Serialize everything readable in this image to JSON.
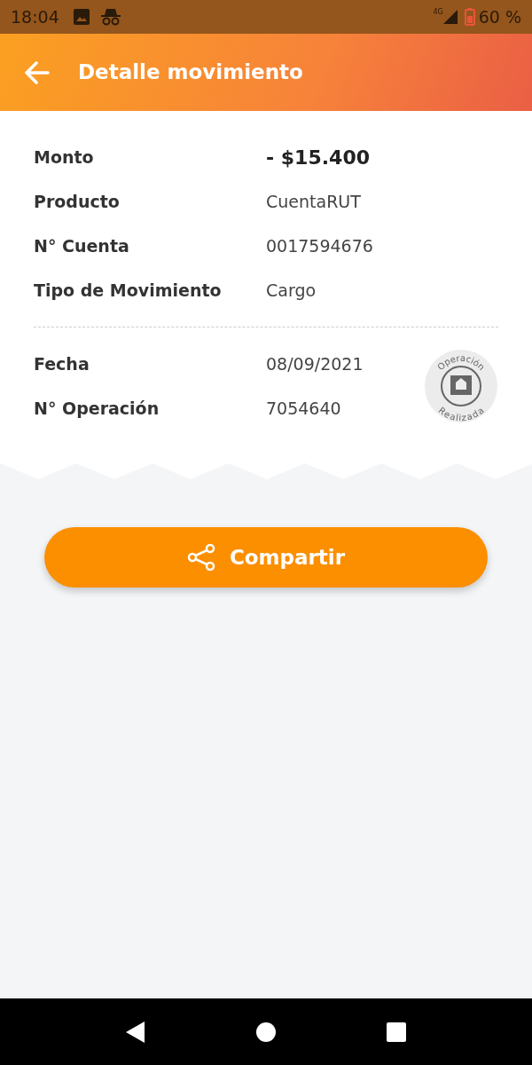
{
  "status_bar": {
    "time": "18:04",
    "network": "4G",
    "battery": "60 %"
  },
  "header": {
    "title": "Detalle movimiento"
  },
  "details": [
    {
      "label": "Monto",
      "value": "- $15.400",
      "emphasis": true
    },
    {
      "label": "Producto",
      "value": "CuentaRUT",
      "emphasis": false
    },
    {
      "label": "N° Cuenta",
      "value": "0017594676",
      "emphasis": false
    },
    {
      "label": "Tipo de Movimiento",
      "value": "Cargo",
      "emphasis": false
    }
  ],
  "operation": [
    {
      "label": "Fecha",
      "value": "08/09/2021"
    },
    {
      "label": "N° Operación",
      "value": "7054640"
    }
  ],
  "stamp": {
    "top": "Operación",
    "bottom": "Realizada"
  },
  "share_button": {
    "label": "Compartir"
  }
}
